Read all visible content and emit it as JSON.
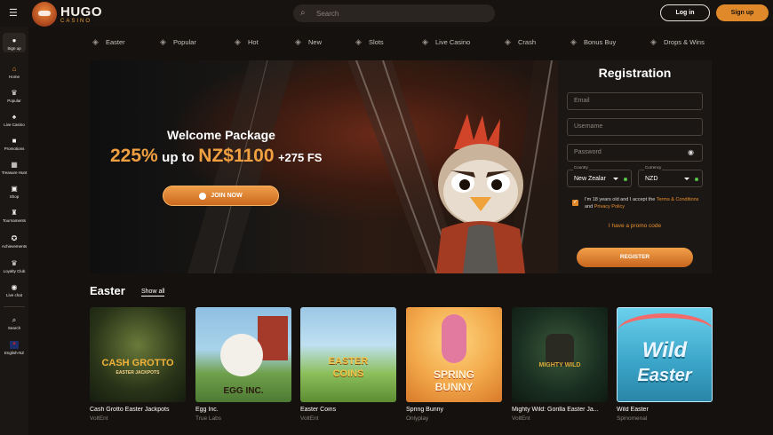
{
  "header": {
    "logo_text": "HUGO",
    "logo_sub": "CASINO",
    "search_placeholder": "Search",
    "login_label": "Log in",
    "signup_label": "Sign up"
  },
  "sidebar": {
    "items": [
      {
        "label": "Sign up",
        "icon": "user-icon"
      },
      {
        "label": "Home",
        "icon": "home-icon"
      },
      {
        "label": "Popular",
        "icon": "crown-icon"
      },
      {
        "label": "Live Casino",
        "icon": "cards-icon"
      },
      {
        "label": "Promotions",
        "icon": "gift-icon"
      },
      {
        "label": "Treasure Hunt",
        "icon": "map-icon"
      },
      {
        "label": "Shop",
        "icon": "shop-icon"
      },
      {
        "label": "Tournaments",
        "icon": "trophy-icon"
      },
      {
        "label": "Achievements",
        "icon": "medal-icon"
      },
      {
        "label": "Loyalty Club",
        "icon": "crown-icon"
      },
      {
        "label": "Live chat",
        "icon": "chat-icon"
      },
      {
        "label": "Search",
        "icon": "search-icon"
      },
      {
        "label": "English-NZ",
        "icon": "flag-nz-icon"
      }
    ]
  },
  "categories": [
    {
      "label": "Easter",
      "icon": "diamond-icon"
    },
    {
      "label": "Popular",
      "icon": "diamond-icon"
    },
    {
      "label": "Hot",
      "icon": "flame-icon"
    },
    {
      "label": "New",
      "icon": "diamond-icon"
    },
    {
      "label": "Slots",
      "icon": "slot-icon"
    },
    {
      "label": "Live Casino",
      "icon": "diamond-icon"
    },
    {
      "label": "Crash",
      "icon": "rocket-icon"
    },
    {
      "label": "Bonus Buy",
      "icon": "diamond-icon"
    },
    {
      "label": "Drops & Wins",
      "icon": "diamond-icon"
    }
  ],
  "hero": {
    "title": "Welcome Package",
    "percent": "225%",
    "up_to": "up to",
    "amount": "NZ$1100",
    "free_spins": "+275 FS",
    "join_label": "JOIN NOW"
  },
  "registration": {
    "title": "Registration",
    "email_placeholder": "Email",
    "username_placeholder": "Username",
    "password_placeholder": "Password",
    "country_label": "Country",
    "country_value": "New Zealar",
    "currency_label": "Currency",
    "currency_value": "NZD",
    "terms_prefix": "I'm 18 years old and I accept the ",
    "terms_link": "Terms & Conditions",
    "terms_and": " and ",
    "privacy_link": "Privacy Policy",
    "promo_label": "I have a promo code",
    "register_label": "REGISTER"
  },
  "section": {
    "title": "Easter",
    "show_all": "Show all"
  },
  "games": [
    {
      "name": "Cash Grotto Easter Jackpots",
      "provider": "VoltEnt",
      "art": "CASH GROTTO",
      "art_sub": "EASTER JACKPOTS",
      "bg": "#2e3a1e",
      "fg": "#f0b23a"
    },
    {
      "name": "Egg Inc.",
      "provider": "True Labs",
      "art": "EGG INC.",
      "art_sub": "",
      "bg": "#7fb2d8",
      "fg": "#2a1a10"
    },
    {
      "name": "Easter Coins",
      "provider": "VoltEnt",
      "art": "EASTER",
      "art_sub": "COINS",
      "bg": "#8fb86a",
      "fg": "#f3c54a"
    },
    {
      "name": "Spring Bunny",
      "provider": "Onlyplay",
      "art": "SPRING",
      "art_sub": "BUNNY",
      "bg": "#f2b24a",
      "fg": "#fff4d6"
    },
    {
      "name": "Mighty Wild: Gorilla Easter Ja...",
      "provider": "VoltEnt",
      "art": "MIGHTY WILD",
      "art_sub": "",
      "bg": "#1e3526",
      "fg": "#d9a93a"
    },
    {
      "name": "Wild Easter",
      "provider": "Spinomenal",
      "art": "Wild",
      "art_sub": "Easter",
      "bg": "#36a3c4",
      "fg": "#eaf6ff"
    }
  ]
}
